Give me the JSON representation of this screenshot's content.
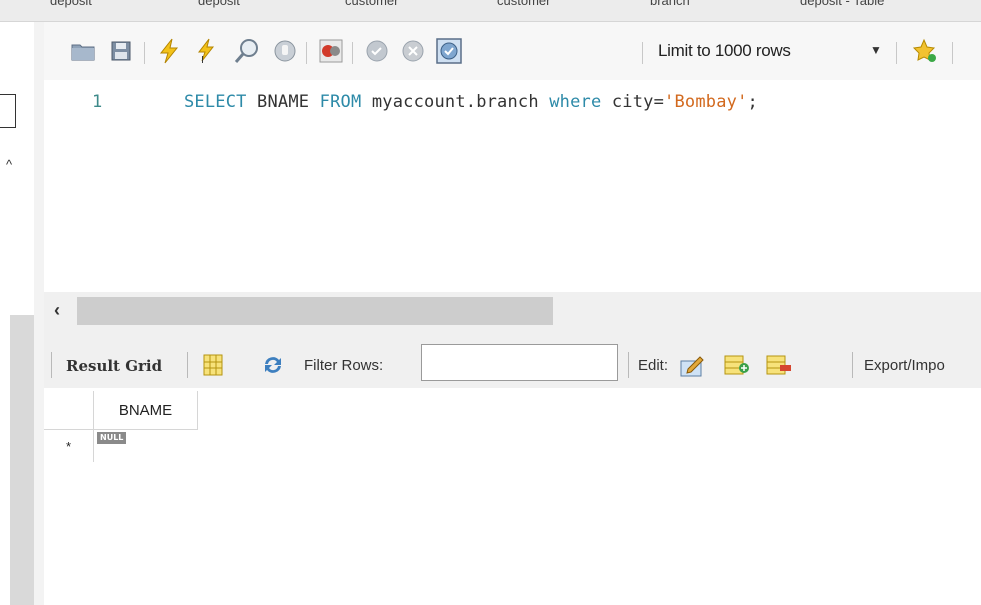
{
  "tabs": [
    {
      "label": "deposit"
    },
    {
      "label": "deposit"
    },
    {
      "label": "customer"
    },
    {
      "label": "customer"
    },
    {
      "label": "branch"
    },
    {
      "label": "deposit - Table"
    }
  ],
  "toolbar": {
    "icons": [
      "open-folder-icon",
      "save-icon",
      "execute-icon",
      "execute-current-icon",
      "explain-icon",
      "stop-icon",
      "toggle-error-icon",
      "commit-icon",
      "rollback-icon",
      "autocommit-icon",
      "beautify-icon"
    ],
    "limit_rows_label": "Limit to 1000 rows"
  },
  "editor": {
    "line_number": "1",
    "tokens": {
      "kw1": "SELECT",
      "t1": " BNAME ",
      "kw2": "FROM",
      "t2": " myaccount.branch ",
      "kw3": "where",
      "t3": " city=",
      "str1": "'Bombay'",
      "t4": ";"
    }
  },
  "results": {
    "result_grid_label": "Result Grid",
    "filter_label": "Filter Rows:",
    "filter_value": "",
    "edit_label": "Edit:",
    "export_label": "Export/Impo",
    "columns": [
      "BNAME"
    ],
    "row_indicator": "*",
    "null_label": "NULL"
  },
  "colors": {
    "keyword": "#2d8aa8",
    "string": "#d2691e",
    "line_number": "#3d8a8a"
  }
}
